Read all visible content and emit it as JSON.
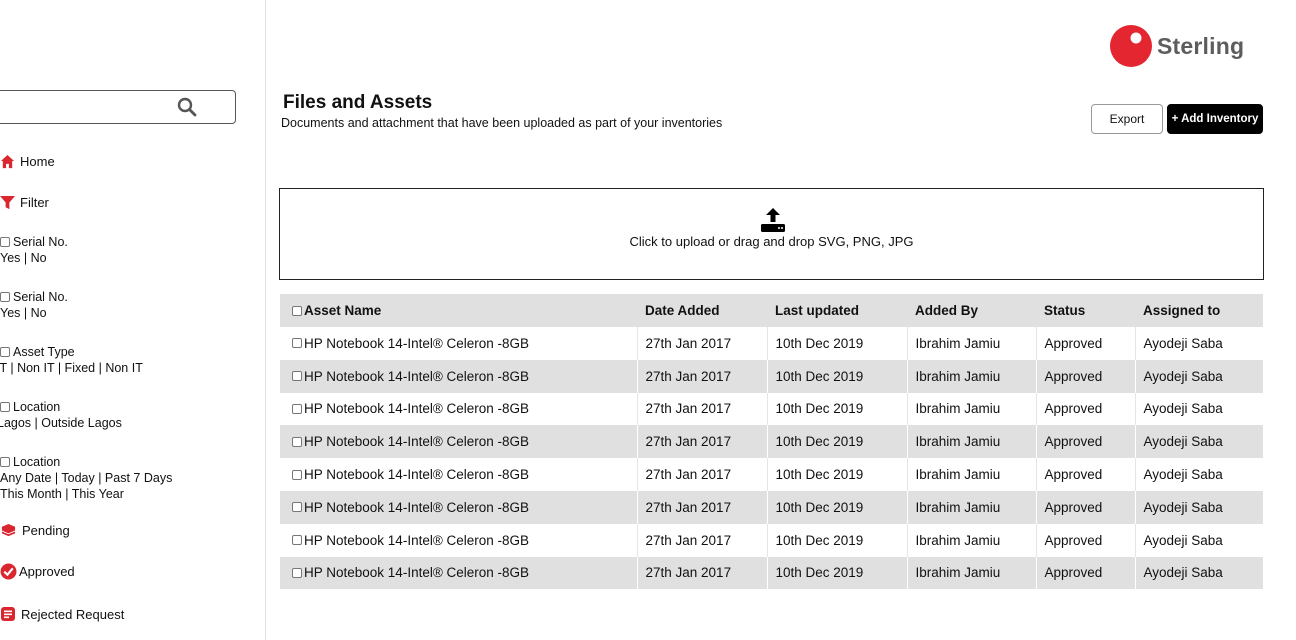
{
  "brand": {
    "name": "Sterling",
    "color": "#e3262f"
  },
  "sidebar": {
    "search": {
      "placeholder": ""
    },
    "home_label": "Home",
    "filter_label": "Filter",
    "filters": [
      {
        "label": "Serial No.",
        "options": "Yes | No"
      },
      {
        "label": "Serial No.",
        "options": "Yes | No"
      },
      {
        "label": "Asset Type",
        "options": "IT | Non IT | Fixed | Non IT"
      },
      {
        "label": "Location",
        "options": "Lagos | Outside Lagos"
      },
      {
        "label": "Location",
        "options": "Any Date | Today | Past 7 Days",
        "options2": "This Month | This Year"
      }
    ],
    "pending_label": "Pending",
    "approved_label": "Approved",
    "rejected_label": "Rejected Request"
  },
  "header": {
    "title": "Files and Assets",
    "subtitle": "Documents and attachment that have been uploaded as part of your inventories",
    "export_label": "Export",
    "add_label": "+ Add Inventory"
  },
  "upload": {
    "text": "Click to upload or drag and drop SVG, PNG, JPG"
  },
  "table": {
    "headers": [
      "Asset Name",
      "Date Added",
      "Last updated",
      "Added By",
      "Status",
      "Assigned to"
    ],
    "rows": [
      [
        "HP Notebook 14-Intel® Celeron -8GB",
        "27th Jan 2017",
        "10th Dec 2019",
        "Ibrahim Jamiu",
        "Approved",
        "Ayodeji Saba"
      ],
      [
        "HP Notebook 14-Intel® Celeron -8GB",
        "27th Jan 2017",
        "10th Dec 2019",
        "Ibrahim Jamiu",
        "Approved",
        "Ayodeji Saba"
      ],
      [
        "HP Notebook 14-Intel® Celeron -8GB",
        "27th Jan 2017",
        "10th Dec 2019",
        "Ibrahim Jamiu",
        "Approved",
        "Ayodeji Saba"
      ],
      [
        "HP Notebook 14-Intel® Celeron -8GB",
        "27th Jan 2017",
        "10th Dec 2019",
        "Ibrahim Jamiu",
        "Approved",
        "Ayodeji Saba"
      ],
      [
        "HP Notebook 14-Intel® Celeron -8GB",
        "27th Jan 2017",
        "10th Dec 2019",
        "Ibrahim Jamiu",
        "Approved",
        "Ayodeji Saba"
      ],
      [
        "HP Notebook 14-Intel® Celeron -8GB",
        "27th Jan 2017",
        "10th Dec 2019",
        "Ibrahim Jamiu",
        "Approved",
        "Ayodeji Saba"
      ],
      [
        "HP Notebook 14-Intel® Celeron -8GB",
        "27th Jan 2017",
        "10th Dec 2019",
        "Ibrahim Jamiu",
        "Approved",
        "Ayodeji Saba"
      ],
      [
        "HP Notebook 14-Intel® Celeron -8GB",
        "27th Jan 2017",
        "10th Dec 2019",
        "Ibrahim Jamiu",
        "Approved",
        "Ayodeji Saba"
      ]
    ]
  }
}
